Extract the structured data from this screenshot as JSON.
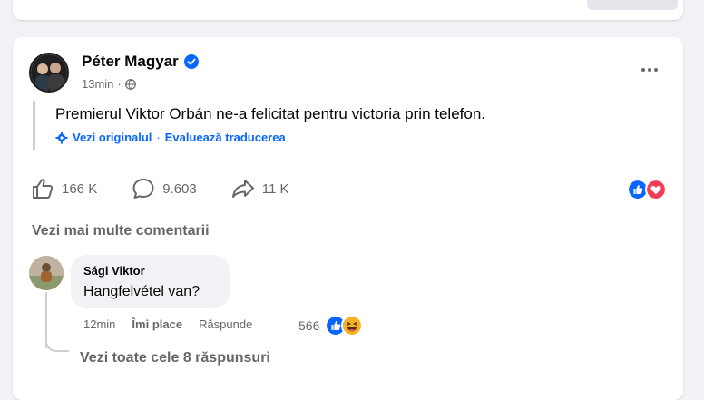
{
  "post": {
    "author": "Péter Magyar",
    "time": "13min",
    "separator": "·",
    "text": "Premierul Viktor Orbán ne-a felicitat pentru victoria prin telefon.",
    "see_original": "Vezi originalul",
    "translate_sep": "·",
    "rate_translation": "Evaluează traducerea",
    "likes": "166 K",
    "comments": "9.603",
    "shares": "11 K"
  },
  "comments_section": {
    "more_comments": "Vezi mai multe comentarii",
    "comment": {
      "name": "Sági Viktor",
      "text": "Hangfelvétel van?",
      "time": "12min",
      "like_label": "Îmi place",
      "reply_label": "Răspunde",
      "reaction_count": "566"
    },
    "all_replies": "Vezi toate cele 8 răspunsuri"
  },
  "colors": {
    "brand_blue": "#0866ff",
    "love_red": "#f33e58",
    "haha_yellow": "#f7b125",
    "muted": "#65676b"
  }
}
